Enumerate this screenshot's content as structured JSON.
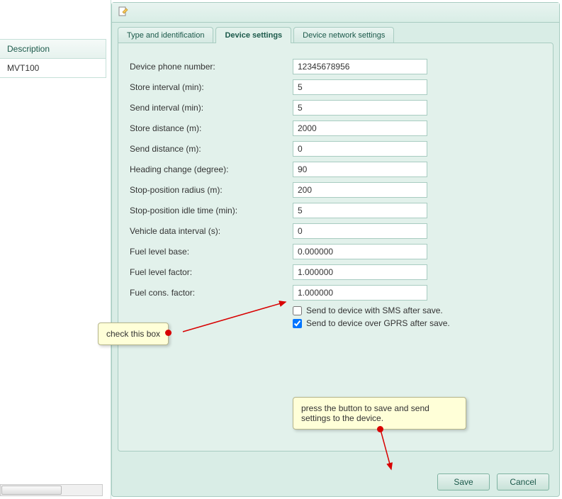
{
  "sidebar": {
    "header": "Description",
    "items": [
      "MVT100"
    ]
  },
  "toolbar": {
    "icon": "document-edit-icon"
  },
  "tabs": [
    {
      "label": "Type and identification",
      "active": false
    },
    {
      "label": "Device settings",
      "active": true
    },
    {
      "label": "Device network settings",
      "active": false
    }
  ],
  "form": {
    "fields": [
      {
        "label": "Device phone number:",
        "value": "12345678956"
      },
      {
        "label": "Store interval (min):",
        "value": "5"
      },
      {
        "label": "Send interval (min):",
        "value": "5"
      },
      {
        "label": "Store distance (m):",
        "value": "2000"
      },
      {
        "label": "Send distance (m):",
        "value": "0"
      },
      {
        "label": "Heading change (degree):",
        "value": "90"
      },
      {
        "label": "Stop-position radius (m):",
        "value": "200"
      },
      {
        "label": "Stop-position idle time (min):",
        "value": "5"
      },
      {
        "label": "Vehicle data interval (s):",
        "value": "0"
      },
      {
        "label": "Fuel level base:",
        "value": "0.000000"
      },
      {
        "label": "Fuel level factor:",
        "value": "1.000000"
      },
      {
        "label": "Fuel cons. factor:",
        "value": "1.000000"
      }
    ],
    "checkboxes": [
      {
        "label": "Send to device with SMS after save.",
        "checked": false
      },
      {
        "label": "Send to device over GPRS after save.",
        "checked": true
      }
    ]
  },
  "buttons": {
    "save": "Save",
    "cancel": "Cancel"
  },
  "callouts": {
    "checkbox": "check this box",
    "save": "press the button to save and send settings to the device."
  }
}
